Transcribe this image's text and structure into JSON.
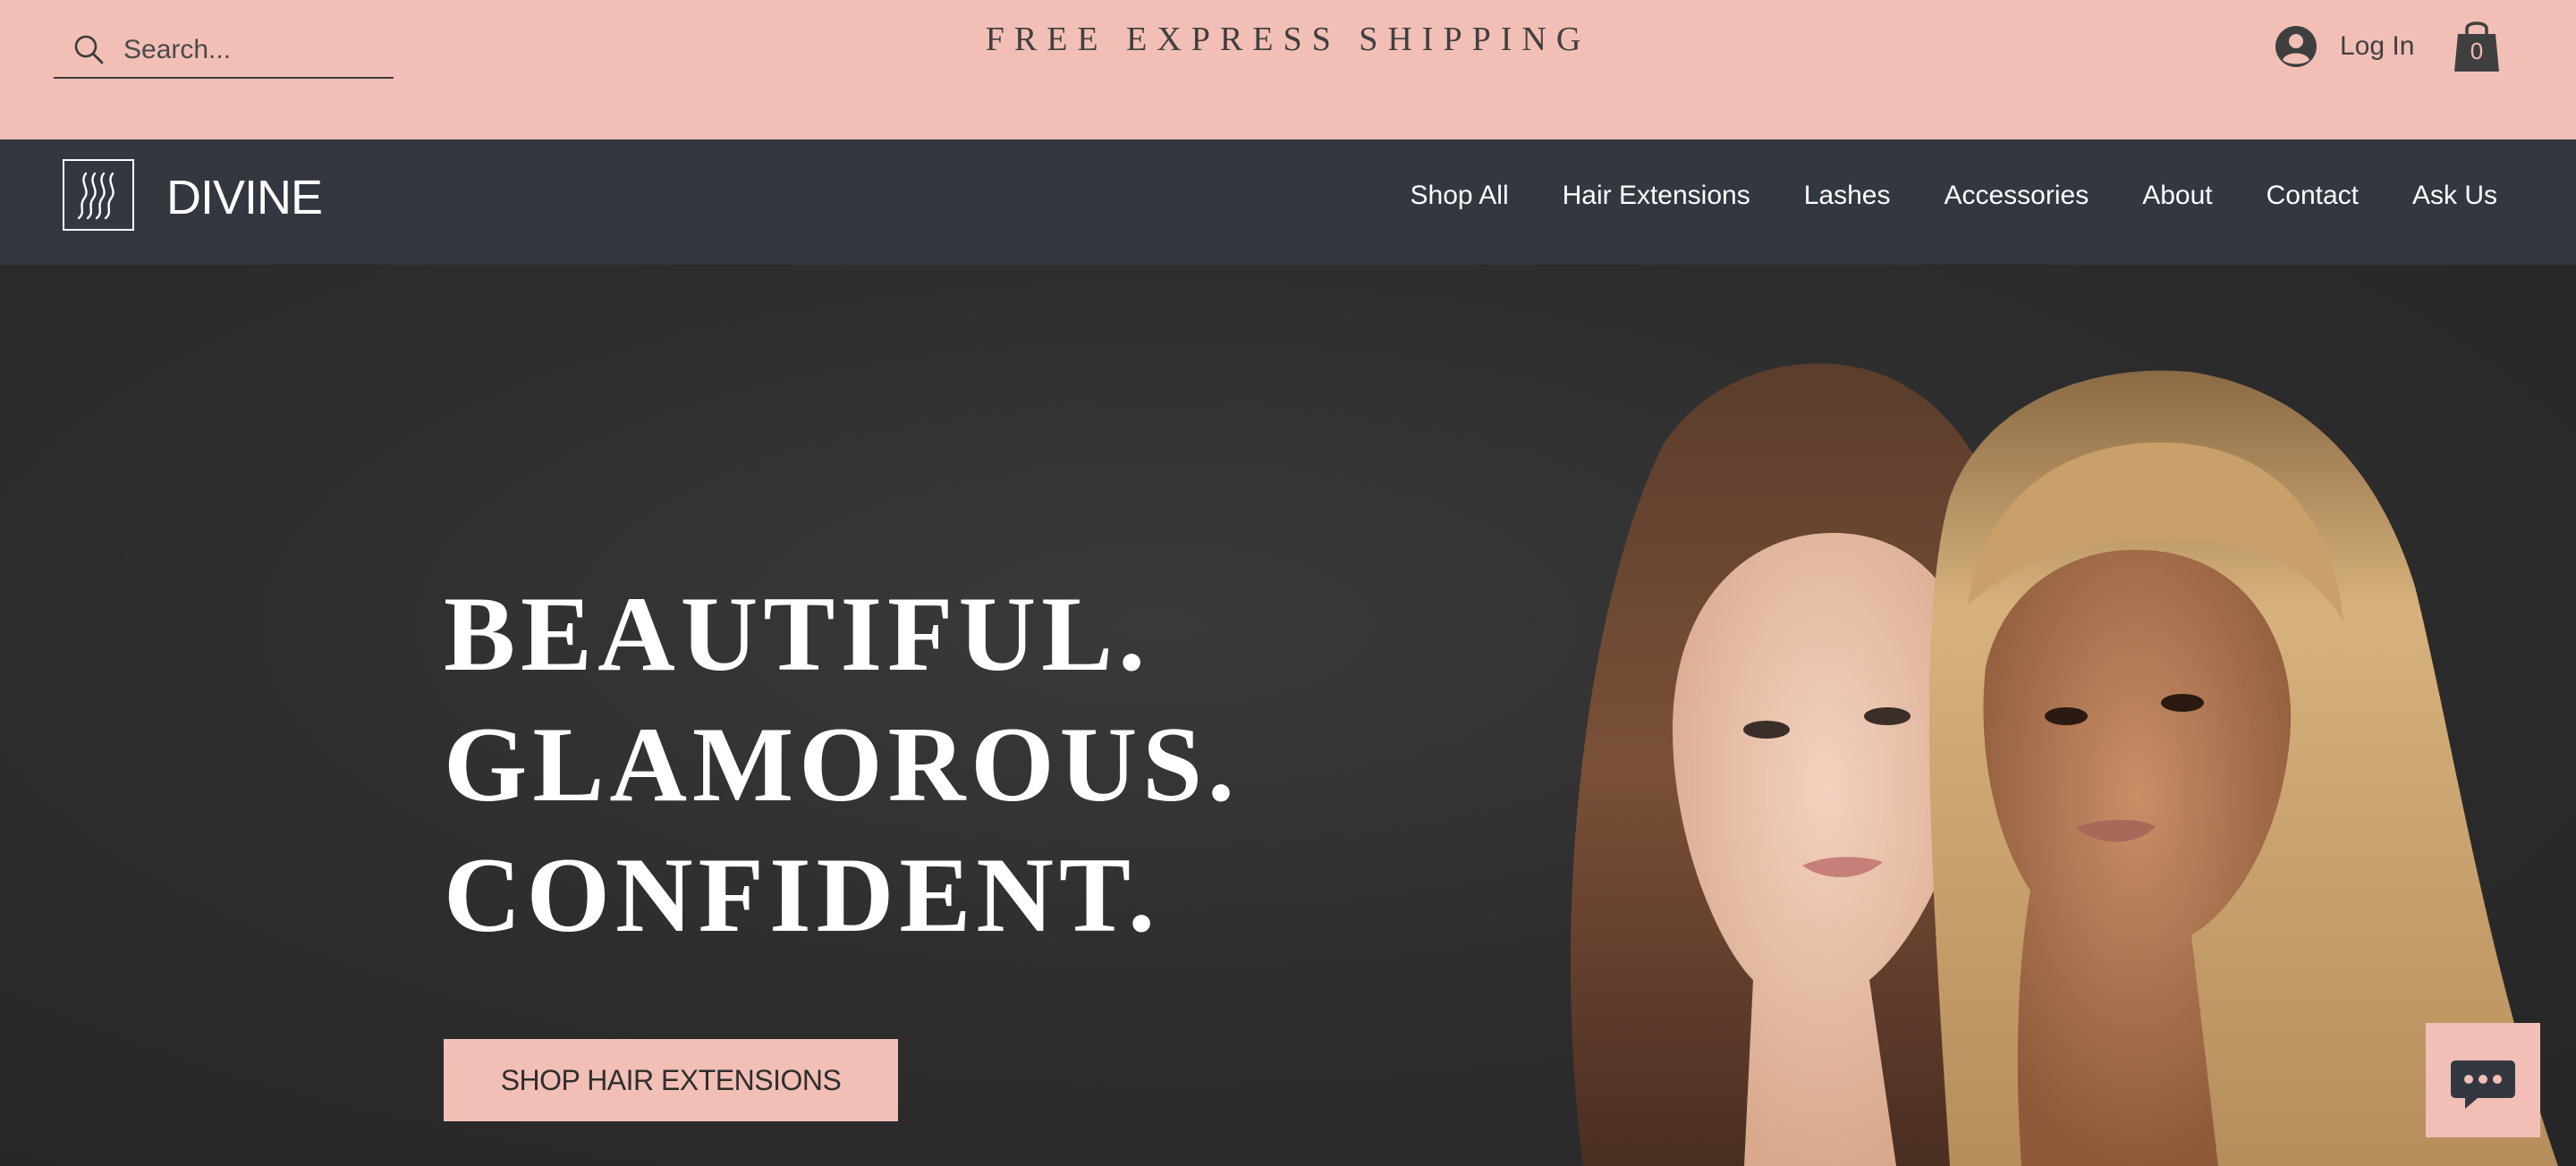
{
  "topbar": {
    "search": {
      "placeholder": "Search...",
      "value": ""
    },
    "promo_text": "FREE EXPRESS SHIPPING",
    "login_label": "Log In",
    "cart_count": "0"
  },
  "navbar": {
    "brand": "DIVINE",
    "items": [
      {
        "label": "Shop All"
      },
      {
        "label": "Hair Extensions"
      },
      {
        "label": "Lashes"
      },
      {
        "label": "Accessories"
      },
      {
        "label": "About"
      },
      {
        "label": "Contact"
      },
      {
        "label": "Ask Us"
      }
    ]
  },
  "hero": {
    "headline": [
      "BEAUTIFUL.",
      "GLAMOROUS.",
      "CONFIDENT."
    ],
    "cta_label": "SHOP HAIR EXTENSIONS"
  },
  "icons": {
    "search": "search-icon",
    "account": "user-avatar-icon",
    "cart": "shopping-bag-icon",
    "logo": "wavy-lines-logo-icon",
    "chat": "chat-bubble-icon"
  },
  "colors": {
    "promo_bar": "#f2bfb6",
    "nav_bar": "#333740",
    "hero_bg": "#2b2b2c",
    "accent": "#f2bfb6",
    "text_dark": "#3f3f3f",
    "text_light": "#ffffff"
  }
}
